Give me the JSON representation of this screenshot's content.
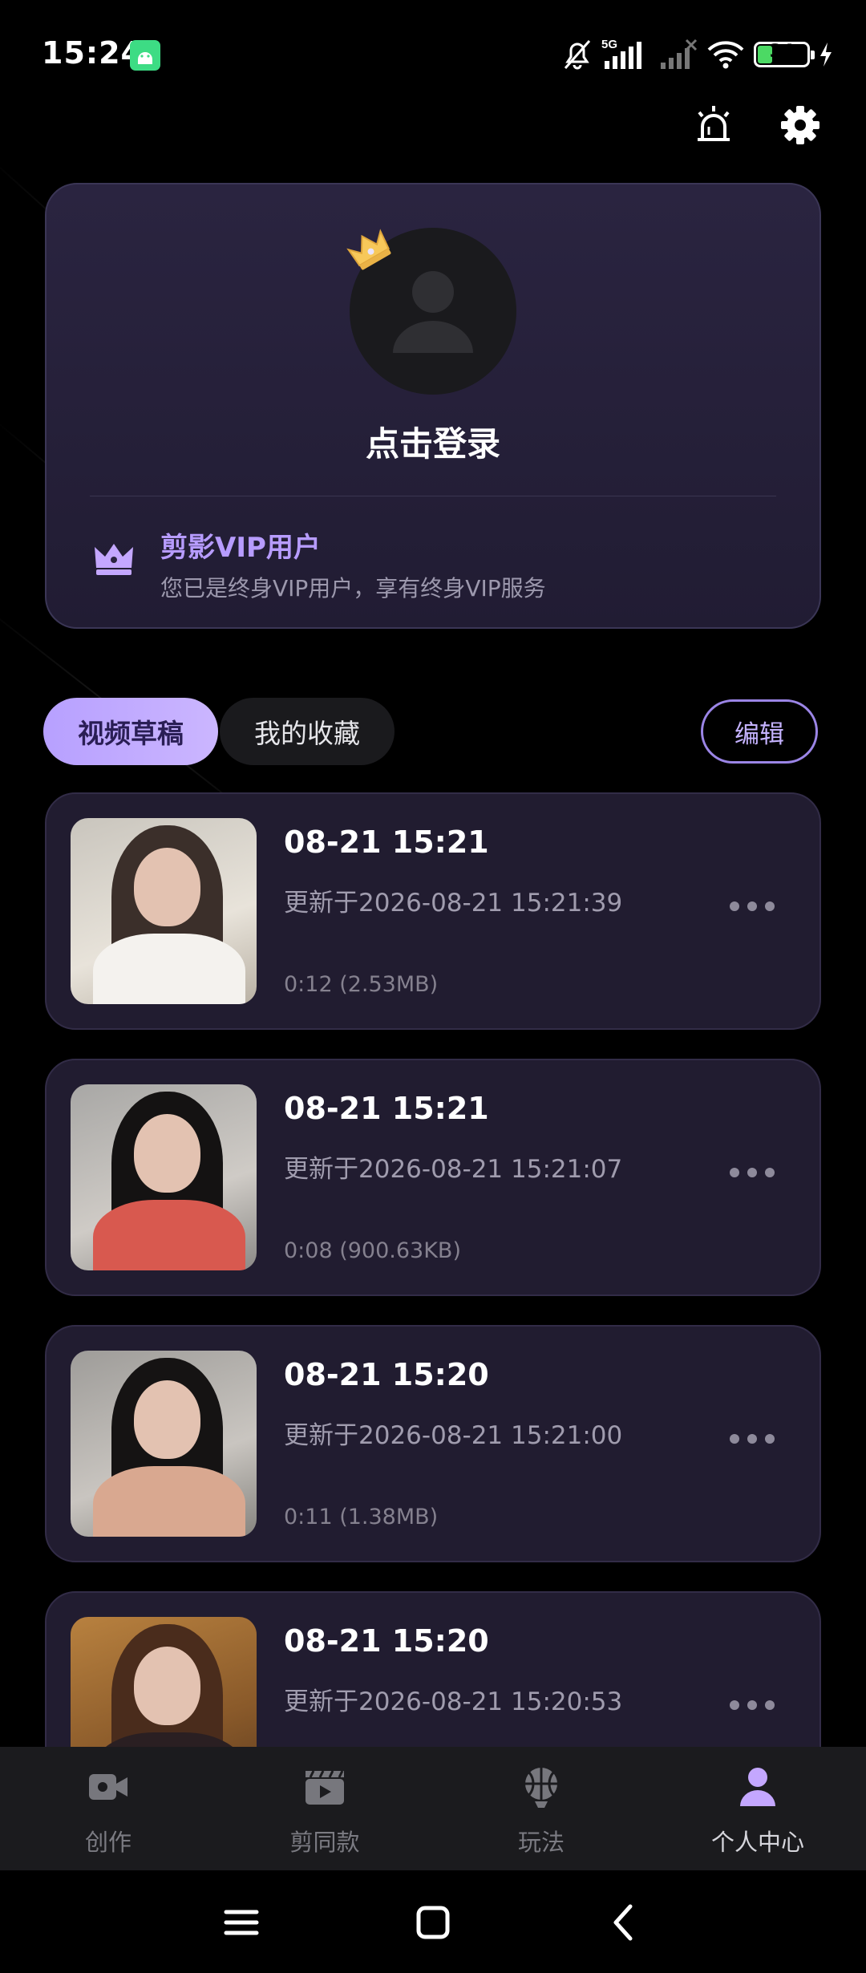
{
  "status_bar": {
    "time": "15:24",
    "network": "5G",
    "battery_level": 34,
    "battery_label": "34"
  },
  "top_actions": {
    "alert_icon": "alarm-light-icon",
    "settings_icon": "gear-icon"
  },
  "profile": {
    "login_label": "点击登录",
    "vip_title": "剪影VIP用户",
    "vip_description": "您已是终身VIP用户，享有终身VIP服务"
  },
  "tabs": [
    {
      "label": "视频草稿",
      "active": true
    },
    {
      "label": "我的收藏",
      "active": false
    }
  ],
  "edit_label": "编辑",
  "drafts": [
    {
      "title": "08-21 15:21",
      "updated": "更新于2026-08-21 15:21:39",
      "meta": "0:12 (2.53MB)"
    },
    {
      "title": "08-21 15:21",
      "updated": "更新于2026-08-21 15:21:07",
      "meta": "0:08 (900.63KB)"
    },
    {
      "title": "08-21 15:20",
      "updated": "更新于2026-08-21 15:21:00",
      "meta": "0:11 (1.38MB)"
    },
    {
      "title": "08-21 15:20",
      "updated": "更新于2026-08-21 15:20:53",
      "meta": ""
    }
  ],
  "bottom_nav": [
    {
      "label": "创作",
      "icon": "video-camera-icon",
      "active": false
    },
    {
      "label": "剪同款",
      "icon": "clapperboard-icon",
      "active": false
    },
    {
      "label": "玩法",
      "icon": "basketball-icon",
      "active": false
    },
    {
      "label": "个人中心",
      "icon": "person-icon",
      "active": true
    }
  ],
  "colors": {
    "accent": "#b79cff",
    "card_bg": "#211c30",
    "nav_bg": "#1b1b1e"
  }
}
